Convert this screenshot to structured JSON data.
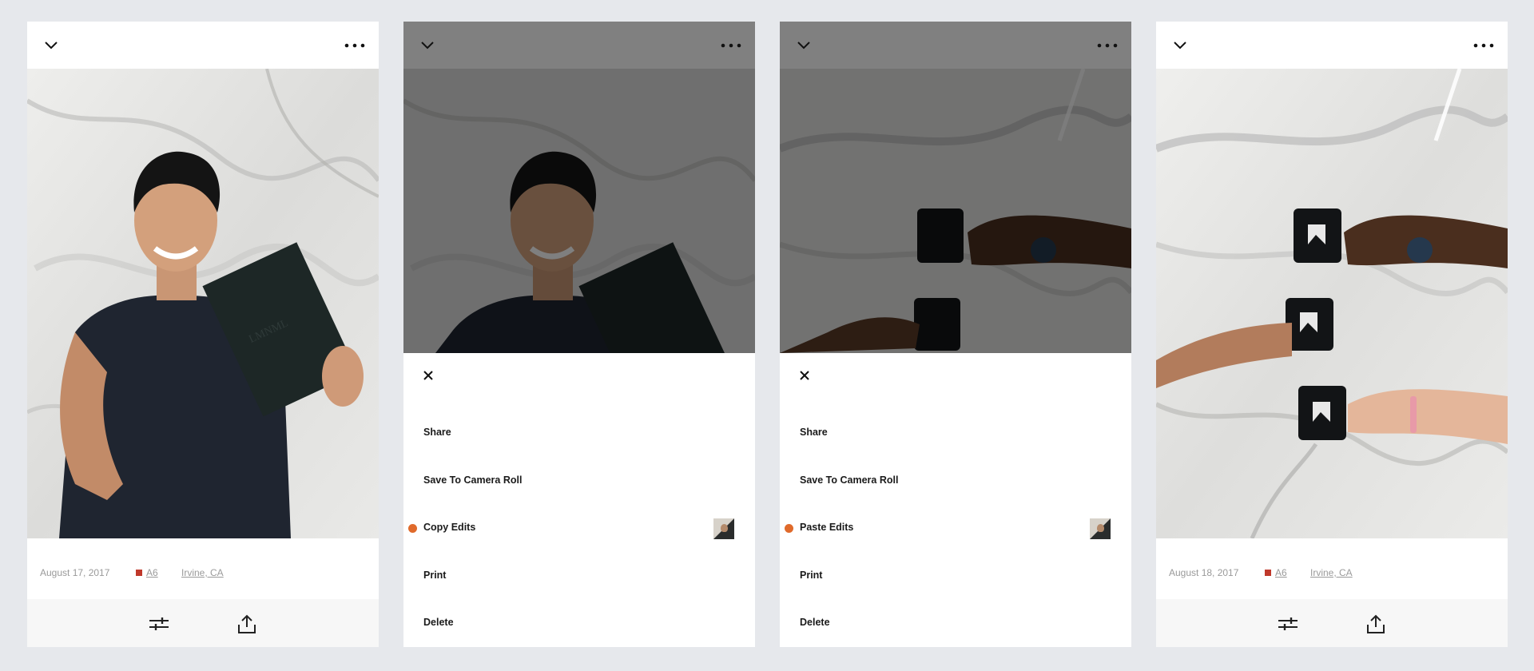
{
  "colors": {
    "page_bg": "#e6e8ec",
    "accent_dot": "#e06a2b",
    "tag_swatch": "#c0392b",
    "overlay": "rgba(0,0,0,0.5)"
  },
  "screens": [
    {
      "id": "photo-detail-portrait",
      "photo_subject": "man holding black notebook against marble wall",
      "meta": {
        "date": "August 17, 2017",
        "tag": "A6",
        "location": "Irvine, CA"
      },
      "icons": {
        "back": "chevron-down-icon",
        "more": "ellipsis-icon",
        "adjust": "sliders-icon",
        "share": "share-icon"
      }
    },
    {
      "id": "photo-menu-copy",
      "menu": {
        "close_icon": "close-icon",
        "items": [
          "Share",
          "Save To Camera Roll",
          "Copy Edits",
          "Print",
          "Delete"
        ],
        "highlighted_index": 2
      }
    },
    {
      "id": "photo-menu-paste",
      "menu": {
        "close_icon": "close-icon",
        "items": [
          "Share",
          "Save To Camera Roll",
          "Paste Edits",
          "Print",
          "Delete"
        ],
        "highlighted_index": 2
      }
    },
    {
      "id": "photo-detail-mugs",
      "photo_subject": "three hands holding black mugs against marble wall",
      "meta": {
        "date": "August 18, 2017",
        "tag": "A6",
        "location": "Irvine, CA"
      }
    }
  ]
}
